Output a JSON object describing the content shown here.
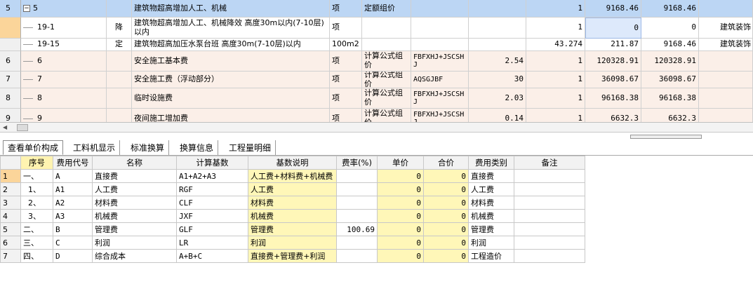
{
  "top_rows": [
    {
      "rownum": "5",
      "code": "5",
      "kind": "",
      "name": "建筑物超高增加人工、机械",
      "unit": "项",
      "qty_expr": "定额组价",
      "basis": "",
      "rate": "",
      "quantity": "1",
      "unit_price": "9168.46",
      "total": "9168.46",
      "specialty": ""
    },
    {
      "rownum": "",
      "code": "19-1",
      "kind": "降",
      "name": "建筑物超高增加人工、机械降效 高度30m以内(7-10层)以内",
      "unit": "项",
      "qty_expr": "",
      "basis": "",
      "rate": "",
      "quantity": "1",
      "unit_price": "0",
      "total": "0",
      "specialty": "建筑装饰"
    },
    {
      "rownum": "",
      "code": "19-15",
      "kind": "定",
      "name": "建筑物超高加压水泵台班 高度30m(7-10层)以内",
      "unit": "100m2",
      "qty_expr": "",
      "basis": "",
      "rate": "",
      "quantity": "43.274",
      "unit_price": "211.87",
      "total": "9168.46",
      "specialty": "建筑装饰"
    },
    {
      "rownum": "6",
      "code": "6",
      "kind": "",
      "name": "安全施工基本费",
      "unit": "项",
      "qty_expr": "计算公式组价",
      "basis": "FBFXHJ+JSCSHJ",
      "rate": "2.54",
      "quantity": "1",
      "unit_price": "120328.91",
      "total": "120328.91",
      "specialty": ""
    },
    {
      "rownum": "7",
      "code": "7",
      "kind": "",
      "name": "安全施工费（浮动部分）",
      "unit": "项",
      "qty_expr": "计算公式组价",
      "basis": "AQSGJBF",
      "rate": "30",
      "quantity": "1",
      "unit_price": "36098.67",
      "total": "36098.67",
      "specialty": ""
    },
    {
      "rownum": "8",
      "code": "8",
      "kind": "",
      "name": "临时设施费",
      "unit": "项",
      "qty_expr": "计算公式组价",
      "basis": "FBFXHJ+JSCSHJ",
      "rate": "2.03",
      "quantity": "1",
      "unit_price": "96168.38",
      "total": "96168.38",
      "specialty": ""
    },
    {
      "rownum": "9",
      "code": "9",
      "kind": "",
      "name": "夜间施工增加费",
      "unit": "项",
      "qty_expr": "计算公式组价",
      "basis": "FBFXHJ+JSCSHJ",
      "rate": "0.14",
      "quantity": "1",
      "unit_price": "6632.3",
      "total": "6632.3",
      "specialty": ""
    }
  ],
  "tabs": [
    "查看单价构成",
    "工料机显示",
    "标准换算",
    "换算信息",
    "工程量明细"
  ],
  "bottom_headers": [
    "序号",
    "费用代号",
    "名称",
    "计算基数",
    "基数说明",
    "费率(%)",
    "单价",
    "合价",
    "费用类别",
    "备注"
  ],
  "bottom_rows": [
    {
      "rn": "1",
      "seq": "一、",
      "code": "A",
      "name": "直接费",
      "base": "A1+A2+A3",
      "desc": "人工费+材料费+机械费",
      "rate": "",
      "price": "0",
      "total": "0",
      "category": "直接费",
      "note": ""
    },
    {
      "rn": "2",
      "seq": "1、",
      "code": "A1",
      "name": "人工费",
      "base": "RGF",
      "desc": "人工费",
      "rate": "",
      "price": "0",
      "total": "0",
      "category": "人工费",
      "note": ""
    },
    {
      "rn": "3",
      "seq": "2、",
      "code": "A2",
      "name": "材料费",
      "base": "CLF",
      "desc": "材料费",
      "rate": "",
      "price": "0",
      "total": "0",
      "category": "材料费",
      "note": ""
    },
    {
      "rn": "4",
      "seq": "3、",
      "code": "A3",
      "name": "机械费",
      "base": "JXF",
      "desc": "机械费",
      "rate": "",
      "price": "0",
      "total": "0",
      "category": "机械费",
      "note": ""
    },
    {
      "rn": "5",
      "seq": "二、",
      "code": "B",
      "name": "管理费",
      "base": "GLF",
      "desc": "管理费",
      "rate": "100.69",
      "price": "0",
      "total": "0",
      "category": "管理费",
      "note": ""
    },
    {
      "rn": "6",
      "seq": "三、",
      "code": "C",
      "name": "利润",
      "base": "LR",
      "desc": "利润",
      "rate": "",
      "price": "0",
      "total": "0",
      "category": "利润",
      "note": ""
    },
    {
      "rn": "7",
      "seq": "四、",
      "code": "D",
      "name": "综合成本",
      "base": "A+B+C",
      "desc": "直接费+管理费+利润",
      "rate": "",
      "price": "0",
      "total": "0",
      "category": "工程造价",
      "note": ""
    }
  ],
  "colors": {
    "selected_row": "#bcd6f4",
    "measure_row": "#fbefe8",
    "highlight_col": "#fff7b8",
    "active_rownum": "#fbd59a"
  }
}
